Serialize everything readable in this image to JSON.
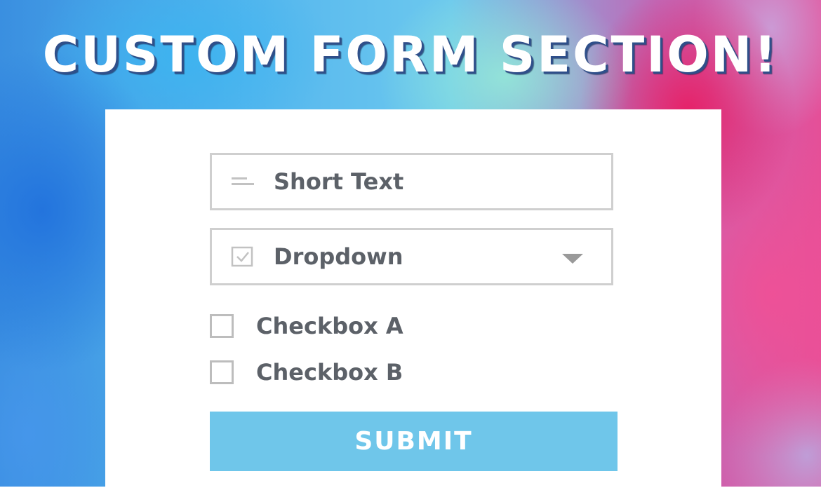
{
  "heading": "CUSTOM FORM SECTION!",
  "form": {
    "short_text": {
      "label": "Short Text",
      "icon": "short-text-icon"
    },
    "dropdown": {
      "label": "Dropdown",
      "icon": "checklist-icon",
      "arrow_icon": "caret-down-icon"
    },
    "checkboxes": [
      {
        "label": "Checkbox A",
        "checked": false
      },
      {
        "label": "Checkbox B",
        "checked": false
      }
    ],
    "submit_label": "SUBMIT"
  },
  "colors": {
    "submit_bg": "#6fc6ea",
    "field_border": "#cfcfcf",
    "label_text": "#5c6168",
    "heading_shadow": "#2f4f8a"
  }
}
